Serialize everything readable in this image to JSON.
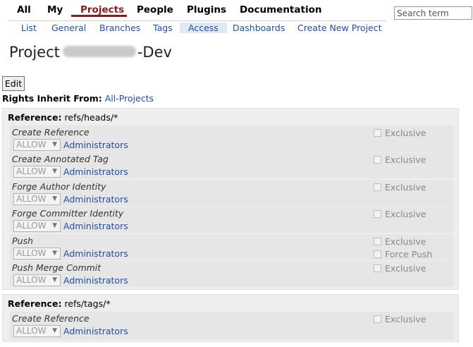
{
  "nav": {
    "items": [
      "All",
      "My",
      "Projects",
      "People",
      "Plugins",
      "Documentation"
    ],
    "active": "Projects"
  },
  "search": {
    "placeholder": "Search term"
  },
  "subnav": {
    "items": [
      "List",
      "General",
      "Branches",
      "Tags",
      "Access",
      "Dashboards",
      "Create New Project"
    ],
    "active": "Access"
  },
  "page": {
    "title_prefix": "Project",
    "title_suffix": "-Dev",
    "edit_label": "Edit",
    "inherit_label": "Rights Inherit From:",
    "inherit_value": "All-Projects"
  },
  "reference_label": "Reference:",
  "references": [
    {
      "name": "refs/heads/*",
      "permissions": [
        {
          "name": "Create Reference",
          "action": "ALLOW",
          "group": "Administrators",
          "options": [
            "Exclusive"
          ]
        },
        {
          "name": "Create Annotated Tag",
          "action": "ALLOW",
          "group": "Administrators",
          "options": [
            "Exclusive"
          ]
        },
        {
          "name": "Forge Author Identity",
          "action": "ALLOW",
          "group": "Administrators",
          "options": [
            "Exclusive"
          ]
        },
        {
          "name": "Forge Committer Identity",
          "action": "ALLOW",
          "group": "Administrators",
          "options": [
            "Exclusive"
          ]
        },
        {
          "name": "Push",
          "action": "ALLOW",
          "group": "Administrators",
          "options": [
            "Exclusive",
            "Force Push"
          ]
        },
        {
          "name": "Push Merge Commit",
          "action": "ALLOW",
          "group": "Administrators",
          "options": [
            "Exclusive"
          ]
        }
      ]
    },
    {
      "name": "refs/tags/*",
      "permissions": [
        {
          "name": "Create Reference",
          "action": "ALLOW",
          "group": "Administrators",
          "options": [
            "Exclusive"
          ]
        }
      ]
    }
  ],
  "colors": {
    "accent": "#8b1a1a",
    "link": "#1f4e9e",
    "panel": "#eeeeee"
  },
  "icons": {
    "select_arrow": "chevron-down-icon",
    "checkbox": "checkbox-icon"
  }
}
